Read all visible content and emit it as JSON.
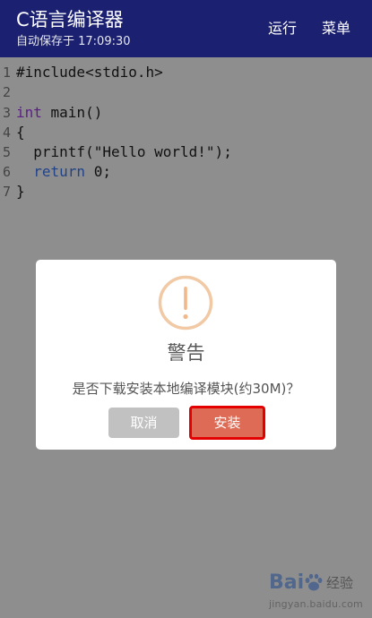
{
  "appbar": {
    "title": "C语言编译器",
    "subtitle": "自动保存于 17:09:30",
    "run_label": "运行",
    "menu_label": "菜单",
    "background_color": "#1b2170"
  },
  "editor": {
    "lines": [
      {
        "num": "1",
        "parts": [
          {
            "t": "#include<stdio.h>",
            "c": ""
          }
        ]
      },
      {
        "num": "2",
        "parts": []
      },
      {
        "num": "3",
        "parts": [
          {
            "t": "int",
            "c": "kw"
          },
          {
            "t": " main()",
            "c": ""
          }
        ]
      },
      {
        "num": "4",
        "parts": [
          {
            "t": "{",
            "c": ""
          }
        ]
      },
      {
        "num": "5",
        "parts": [
          {
            "t": "  printf(\"Hello world!\");",
            "c": ""
          }
        ]
      },
      {
        "num": "6",
        "parts": [
          {
            "t": "  ",
            "c": ""
          },
          {
            "t": "return",
            "c": "kw2"
          },
          {
            "t": " 0;",
            "c": ""
          }
        ]
      },
      {
        "num": "7",
        "parts": [
          {
            "t": "}",
            "c": ""
          }
        ]
      }
    ]
  },
  "dialog": {
    "icon": "exclamation-warning-icon",
    "icon_color": "#f1c9a4",
    "title": "警告",
    "message": "是否下载安装本地编译模块(约30M)？",
    "cancel_label": "取消",
    "confirm_label": "安装",
    "cancel_color": "#c1c1c1",
    "confirm_color": "#dd6b55",
    "highlight_color": "#e40000"
  },
  "watermark": {
    "logo": "Bai",
    "logo_tail": "经验",
    "url": "jingyan.baidu.com"
  }
}
